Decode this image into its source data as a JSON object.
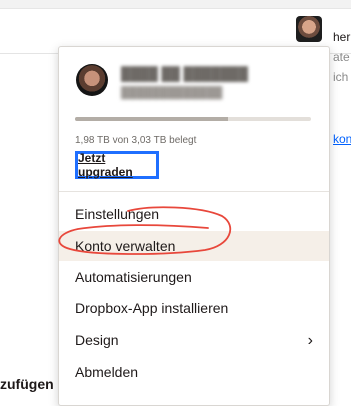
{
  "background": {
    "right_texts": [
      "her",
      "ate",
      "ich",
      "kon"
    ],
    "left_bottom_text": "zufügen"
  },
  "menu": {
    "storage": {
      "used_label": "1,98 TB von 3,03 TB belegt",
      "fraction_used": 0.65
    },
    "upgrade_label": "Jetzt upgraden",
    "items": [
      {
        "label": "Einstellungen"
      },
      {
        "label": "Konto verwalten"
      },
      {
        "label": "Automatisierungen"
      },
      {
        "label": "Dropbox-App installieren"
      },
      {
        "label": "Design",
        "submenu_icon": "chevron-right-icon"
      },
      {
        "label": "Abmelden"
      }
    ]
  },
  "colors": {
    "annotation_red": "#e8473b",
    "focus_blue": "#1f6fff",
    "highlight": "#f5efe8"
  }
}
